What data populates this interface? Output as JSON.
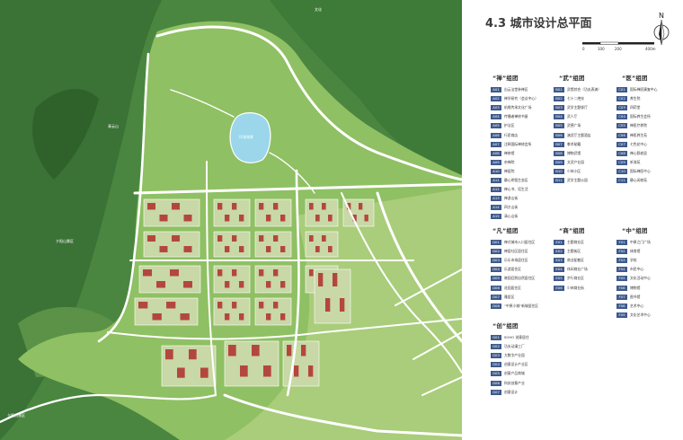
{
  "title": "4.3 城市设计总平面",
  "north_label": "N",
  "scale": {
    "ticks": [
      "0",
      "100",
      "200",
      "400m"
    ]
  },
  "colors": {
    "mountain": "#3d7a3a",
    "hill": "#6fa34c",
    "park": "#8cc063",
    "lake": "#9bd6ea",
    "road": "#ffffff",
    "block": "#c8d8a6",
    "building": "#b4473d",
    "badge": "#3e5a8c"
  },
  "map_labels": {
    "top": "文化",
    "reservoir": "环湖湖景",
    "left_mid": "夕阳山景区",
    "bottom_left": "夕阳山景区",
    "left_upper": "青云山"
  },
  "groups": [
    {
      "title": "“禅”组团",
      "items": [
        {
          "code": "A01",
          "label": "出云法堂参禅区"
        },
        {
          "code": "A02",
          "label": "禅学研究（会议中心）"
        },
        {
          "code": "A03",
          "label": "机缘传承文化广场"
        },
        {
          "code": "A04",
          "label": "传播者禅修书屋"
        },
        {
          "code": "A05",
          "label": "护法区"
        },
        {
          "code": "A06",
          "label": "行愿商店"
        },
        {
          "code": "A07",
          "label": "注释国际禅修会所"
        },
        {
          "code": "A08",
          "label": "禅修馆"
        },
        {
          "code": "A09",
          "label": "杂禅院"
        },
        {
          "code": "A10",
          "label": "禅居院"
        },
        {
          "code": "A11",
          "label": "静心明悟生态区"
        },
        {
          "code": "A12",
          "label": "禅心书、话生活"
        },
        {
          "code": "A13",
          "label": "禅游山街"
        },
        {
          "code": "A14",
          "label": "四方山街"
        },
        {
          "code": "A15",
          "label": "清心山街"
        }
      ]
    },
    {
      "title": "“武”组团",
      "items": [
        {
          "code": "B01",
          "label": "武馆综合（功夫表演）"
        },
        {
          "code": "B02",
          "label": "七十二绝技"
        },
        {
          "code": "B03",
          "label": "武学主题餐厅"
        },
        {
          "code": "B04",
          "label": "武人厅"
        },
        {
          "code": "B05",
          "label": "武德广场"
        },
        {
          "code": "B06",
          "label": "演武厅主题酒店"
        },
        {
          "code": "B07",
          "label": "拳术秘籍"
        },
        {
          "code": "B08",
          "label": "博物武馆"
        },
        {
          "code": "B09",
          "label": "文武产业园"
        },
        {
          "code": "B10",
          "label": "少林小区"
        },
        {
          "code": "B11",
          "label": "武学主题公园"
        }
      ]
    },
    {
      "title": "“医”组团",
      "items": [
        {
          "code": "C01",
          "label": "国际禅医康复中心"
        },
        {
          "code": "C02",
          "label": "养生院"
        },
        {
          "code": "C03",
          "label": "四药堂"
        },
        {
          "code": "C04",
          "label": "国际养生会所"
        },
        {
          "code": "C05",
          "label": "禅医疗养院"
        },
        {
          "code": "C06",
          "label": "禅医养生苑"
        },
        {
          "code": "C07",
          "label": "七色花中心"
        },
        {
          "code": "C08",
          "label": "禅心颐老居"
        },
        {
          "code": "C09",
          "label": "听涛苑"
        },
        {
          "code": "C10",
          "label": "国际禅医中心"
        },
        {
          "code": "C11",
          "label": "静心闲修苑"
        }
      ]
    },
    {
      "title": "“凡”组团",
      "items": [
        {
          "code": "D01",
          "label": "禅式城市入口居住区"
        },
        {
          "code": "D02",
          "label": "禅居社区居住区"
        },
        {
          "code": "D03",
          "label": "乐乐市场居住区"
        },
        {
          "code": "D04",
          "label": "乐游居住区"
        },
        {
          "code": "D05",
          "label": "晓园回到自然居住区"
        },
        {
          "code": "D06",
          "label": "花园居住区"
        },
        {
          "code": "D07",
          "label": "雅居区"
        },
        {
          "code": "D08",
          "label": "“中原小城”新城居住区"
        }
      ]
    },
    {
      "title": "“商”组团",
      "items": [
        {
          "code": "E01",
          "label": "主题商业区"
        },
        {
          "code": "E02",
          "label": "主题街区"
        },
        {
          "code": "E03",
          "label": "商业配套区"
        },
        {
          "code": "E04",
          "label": "休闲商业广场"
        },
        {
          "code": "E05",
          "label": "步行商业区"
        },
        {
          "code": "E06",
          "label": "少林商业街"
        }
      ]
    },
    {
      "title": "“中”组团",
      "items": [
        {
          "code": "F01",
          "label": "中原之门广场"
        },
        {
          "code": "F02",
          "label": "体育馆"
        },
        {
          "code": "F03",
          "label": "学校"
        },
        {
          "code": "F04",
          "label": "市民中心"
        },
        {
          "code": "F05",
          "label": "文化活动中心"
        },
        {
          "code": "F06",
          "label": "博物馆"
        },
        {
          "code": "F07",
          "label": "图书馆"
        },
        {
          "code": "F08",
          "label": "艺术中心"
        },
        {
          "code": "F09",
          "label": "文化艺术中心"
        }
      ]
    },
    {
      "title": "“创”组团",
      "items": [
        {
          "code": "G01",
          "label": "SOHO 创意居住"
        },
        {
          "code": "G02",
          "label": "功夫动漫工厂"
        },
        {
          "code": "G03",
          "label": "大数字产业园"
        },
        {
          "code": "G04",
          "label": "创意设计产业区"
        },
        {
          "code": "G05",
          "label": "创意产品商城"
        },
        {
          "code": "G06",
          "label": "科技创意产业"
        },
        {
          "code": "G07",
          "label": "创意设计"
        }
      ]
    }
  ]
}
